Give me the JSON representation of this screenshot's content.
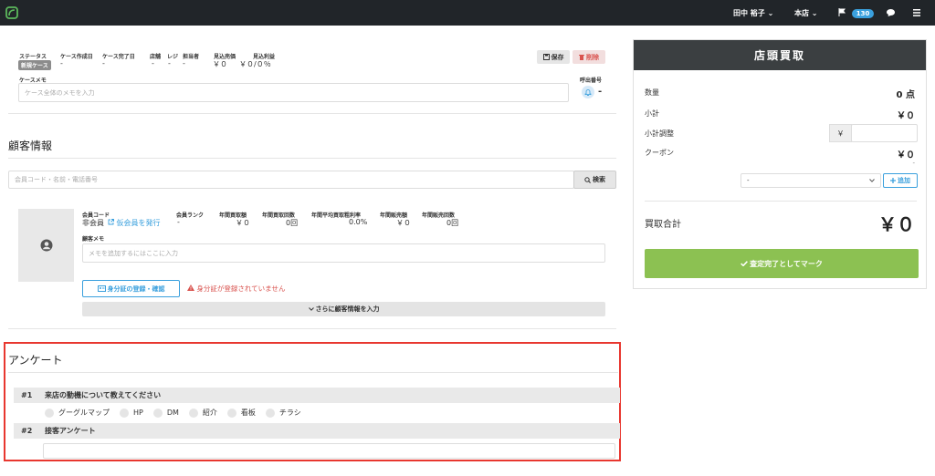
{
  "topbar": {
    "user_name": "田中 裕子 ⌄",
    "store_name": "本店 ⌄",
    "notification_count": "130"
  },
  "case": {
    "status_label": "ステータス",
    "status_badge": "新規ケース",
    "created_label": "ケース作成日",
    "created_value": "-",
    "completed_label": "ケース完了日",
    "completed_value": "-",
    "store_label": "店舗",
    "store_value": "-",
    "register_label": "レジ",
    "register_value": "-",
    "staff_label": "担当者",
    "staff_value": "-",
    "sales_label": "見込売価",
    "sales_value": "￥０",
    "profit_label": "見込利益",
    "profit_value": "￥０/０％",
    "save_label": "保存",
    "delete_label": "削除",
    "memo_label": "ケースメモ",
    "memo_placeholder": "ケース全体のメモを入力",
    "call_label": "呼出番号",
    "call_value": "-"
  },
  "customer": {
    "title": "顧客情報",
    "search_placeholder": "会員コード・名前・電話番号",
    "search_label": "検索",
    "member_code_label": "会員コード",
    "member_code_value": "非会員",
    "issue_temp_link": "仮会員を発行",
    "rank_label": "会員ランク",
    "rank_value": "-",
    "annual_buy_amount_label": "年間買取額",
    "annual_buy_amount_value": "￥０",
    "annual_buy_count_label": "年間買取回数",
    "annual_buy_count_value": "0回",
    "avg_rate_label": "年間平均買取粗利率",
    "avg_rate_value": "0.0%",
    "annual_sales_amount_label": "年間販売額",
    "annual_sales_amount_value": "￥０",
    "annual_sales_count_label": "年間販売回数",
    "annual_sales_count_value": "0回",
    "memo_label": "顧客メモ",
    "memo_placeholder": "メモを追加するにはここに入力",
    "id_button_label": "身分証の登録・確認",
    "id_warning": "身分証が登録されていません",
    "more_info_label": "さらに顧客情報を入力"
  },
  "survey": {
    "title": "アンケート",
    "questions": [
      {
        "number": "#1",
        "text": "来店の動機について教えてください",
        "options": [
          "グーグルマップ",
          "HP",
          "DM",
          "紹介",
          "看板",
          "チラシ"
        ]
      },
      {
        "number": "#2",
        "text": "接客アンケート"
      }
    ]
  },
  "panel": {
    "title": "店頭買取",
    "qty_label": "数量",
    "qty_value": "0 点",
    "subtotal_label": "小計",
    "subtotal_value": "￥０",
    "adjust_label": "小計調整",
    "yen_prefix": "￥",
    "coupon_label": "クーポン",
    "coupon_value": "￥０",
    "coupon_sub": "-",
    "coupon_select": "-",
    "add_label": "追加",
    "total_label": "買取合計",
    "total_value": "￥０",
    "complete_label": "査定完了としてマーク"
  },
  "colors": {
    "topbar": "#212529",
    "accent_blue": "#3aa0dd",
    "delete_red": "#d9534f",
    "success_green": "#8cc152",
    "highlight_red": "#e8372f",
    "panel_header": "#3b3f41"
  }
}
